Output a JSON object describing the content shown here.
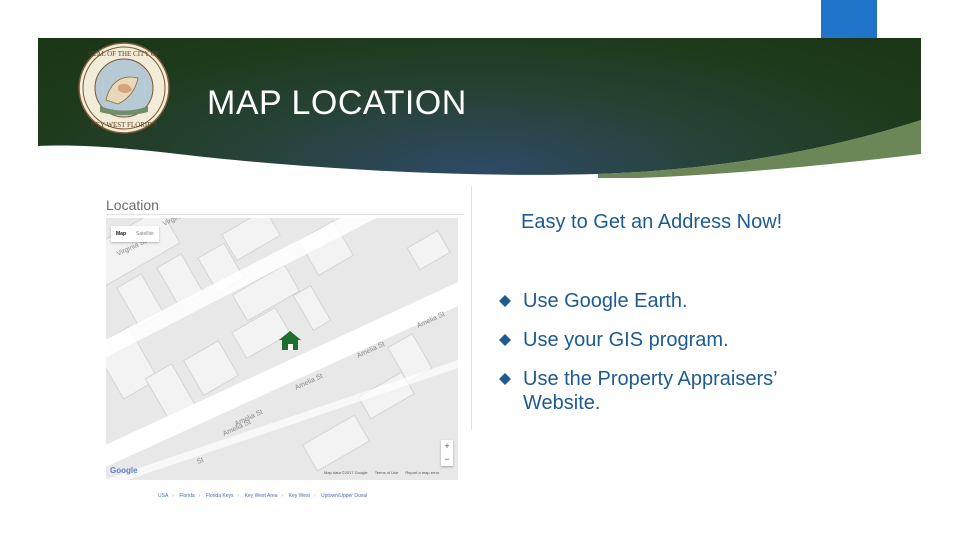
{
  "slide": {
    "title": "MAP LOCATION",
    "seal_text": "SEAL OF THE CITY OF KEY WEST FLORIDA",
    "subtitle": "Easy to Get an Address Now!",
    "bullets": [
      "Use Google Earth.",
      "Use your GIS program.",
      "Use the Property Appraisers’ Website."
    ],
    "colors": {
      "banner": "#1d3a1a",
      "accent": "#1f73c8",
      "text": "#1e5b93"
    }
  },
  "map_panel": {
    "heading": "Location",
    "map_types": {
      "map": "Map",
      "satellite": "Satellite"
    },
    "zoom": {
      "in": "+",
      "out": "−"
    },
    "streets": [
      "Virginia St",
      "Virginia St",
      "Amelia St",
      "Amelia St",
      "Amelia St",
      "Amelia St",
      "Amelia St",
      "St"
    ],
    "marker_icon": "house-icon",
    "google_logo": "Google",
    "attribution": [
      "Map data ©2017 Google",
      "Terms of Use",
      "Report a map error"
    ],
    "breadcrumbs": [
      "USA",
      "Florida",
      "Florida Keys",
      "Key West Area",
      "Key West",
      "Uptown/Upper Duval"
    ]
  }
}
